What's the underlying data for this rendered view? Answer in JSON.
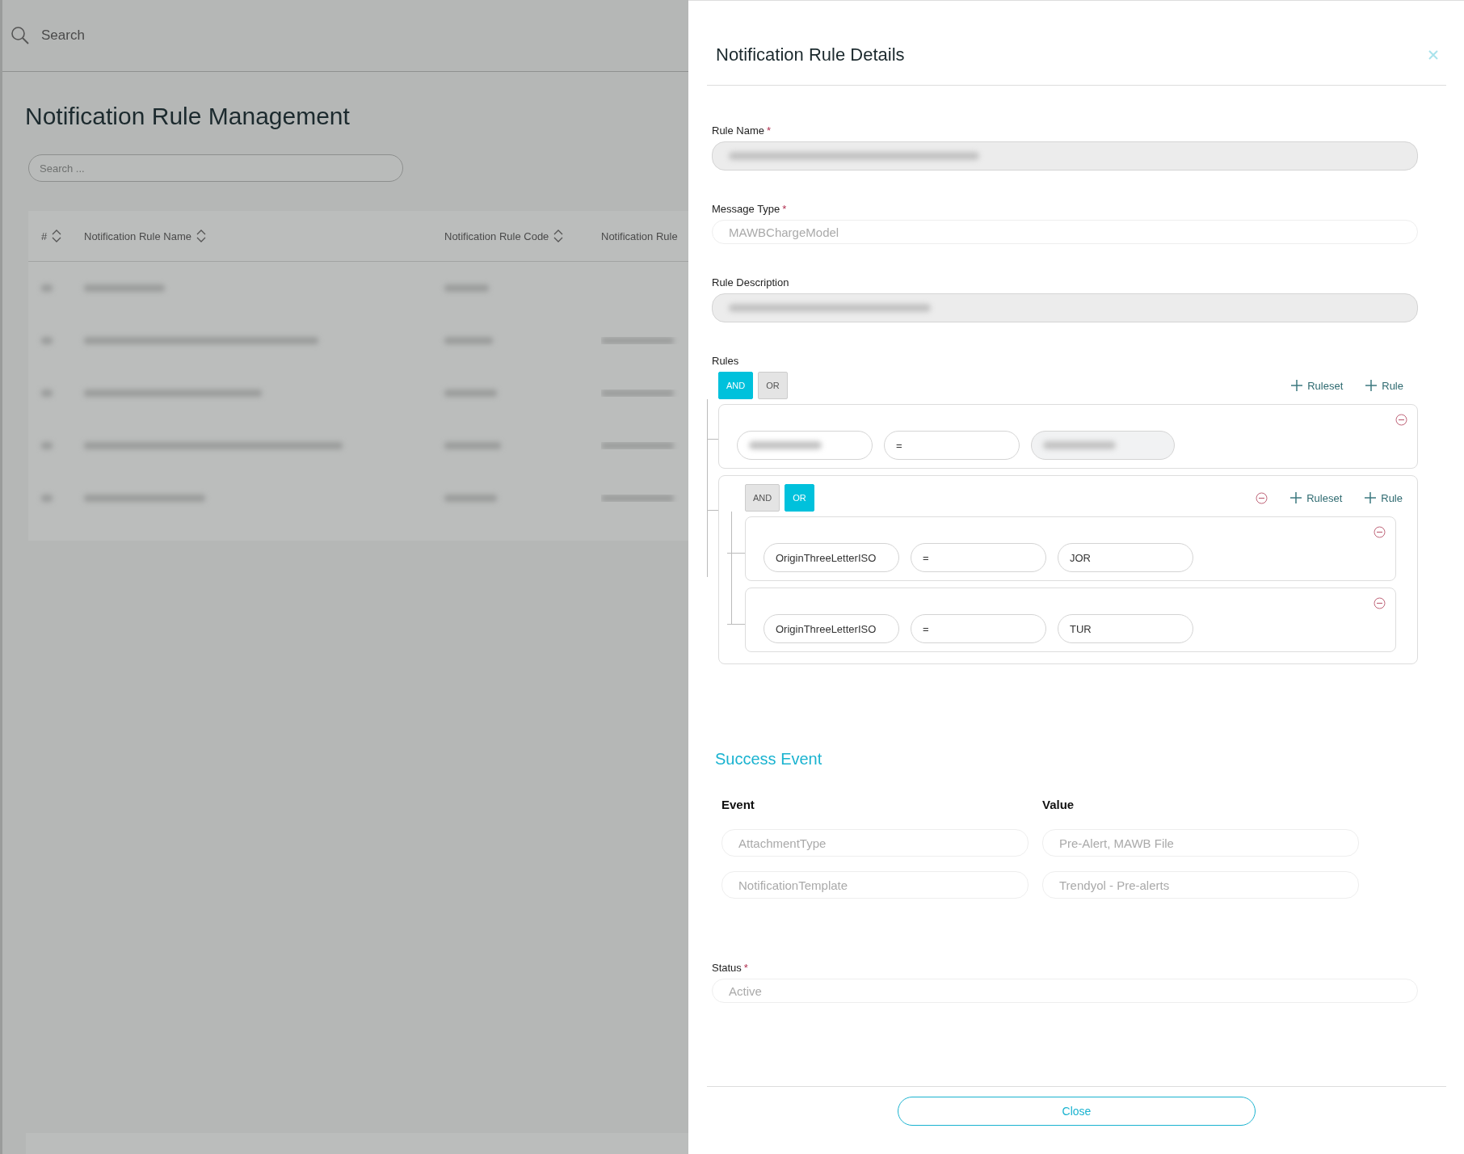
{
  "top_bar": {
    "search_label": "Search"
  },
  "page": {
    "title": "Notification Rule Management",
    "search": {
      "placeholder": "Search ..."
    },
    "table": {
      "columns": [
        {
          "label": "#",
          "sortable": true
        },
        {
          "label": "Notification Rule Name",
          "sortable": true
        },
        {
          "label": "Notification Rule Code",
          "sortable": true
        },
        {
          "label": "Notification Rule",
          "sortable": false
        }
      ]
    }
  },
  "panel": {
    "title": "Notification Rule Details",
    "fields": [
      {
        "label": "Rule Name",
        "required_mark": "*",
        "blurred": true,
        "disabled": true
      },
      {
        "label": "Message Type",
        "required_mark": "*",
        "value": "MAWBChargeModel",
        "blurred": false,
        "disabled": false
      },
      {
        "label": "Rule Description",
        "blurred": true,
        "disabled": true
      }
    ],
    "rules": {
      "label": "Rules",
      "operators": [
        {
          "label": "AND",
          "selected": true
        },
        {
          "label": "OR",
          "selected": false
        }
      ],
      "actions": [
        "Ruleset",
        "Rule"
      ],
      "children": [
        {
          "kind": "rule",
          "field": {
            "blurred": true,
            "disabled": false
          },
          "operator": {
            "text": "=",
            "blurred": false,
            "disabled": false
          },
          "value": {
            "blurred": true,
            "disabled": true
          }
        },
        {
          "kind": "ruleset",
          "operators": [
            {
              "label": "AND",
              "selected": false
            },
            {
              "label": "OR",
              "selected": true
            }
          ],
          "actions": [
            "Ruleset",
            "Rule"
          ],
          "children": [
            {
              "kind": "rule",
              "field": {
                "text": "OriginThreeLetterISO",
                "blurred": false,
                "disabled": false
              },
              "operator": {
                "text": "=",
                "blurred": false,
                "disabled": false
              },
              "value": {
                "text": "JOR",
                "blurred": false,
                "disabled": false
              }
            },
            {
              "kind": "rule",
              "field": {
                "text": "OriginThreeLetterISO",
                "blurred": false,
                "disabled": false
              },
              "operator": {
                "text": "=",
                "blurred": false,
                "disabled": false
              },
              "value": {
                "text": "TUR",
                "blurred": false,
                "disabled": false
              }
            }
          ]
        }
      ]
    },
    "success_event": {
      "title": "Success Event",
      "columns": [
        "Event",
        "Value"
      ],
      "rows": [
        {
          "event": "AttachmentType",
          "value": "Pre-Alert, MAWB File"
        },
        {
          "event": "NotificationTemplate",
          "value": "Trendyol - Pre-alerts"
        }
      ]
    },
    "status": {
      "label": "Status",
      "required_mark": "*",
      "value": "Active"
    },
    "close_button": "Close"
  }
}
